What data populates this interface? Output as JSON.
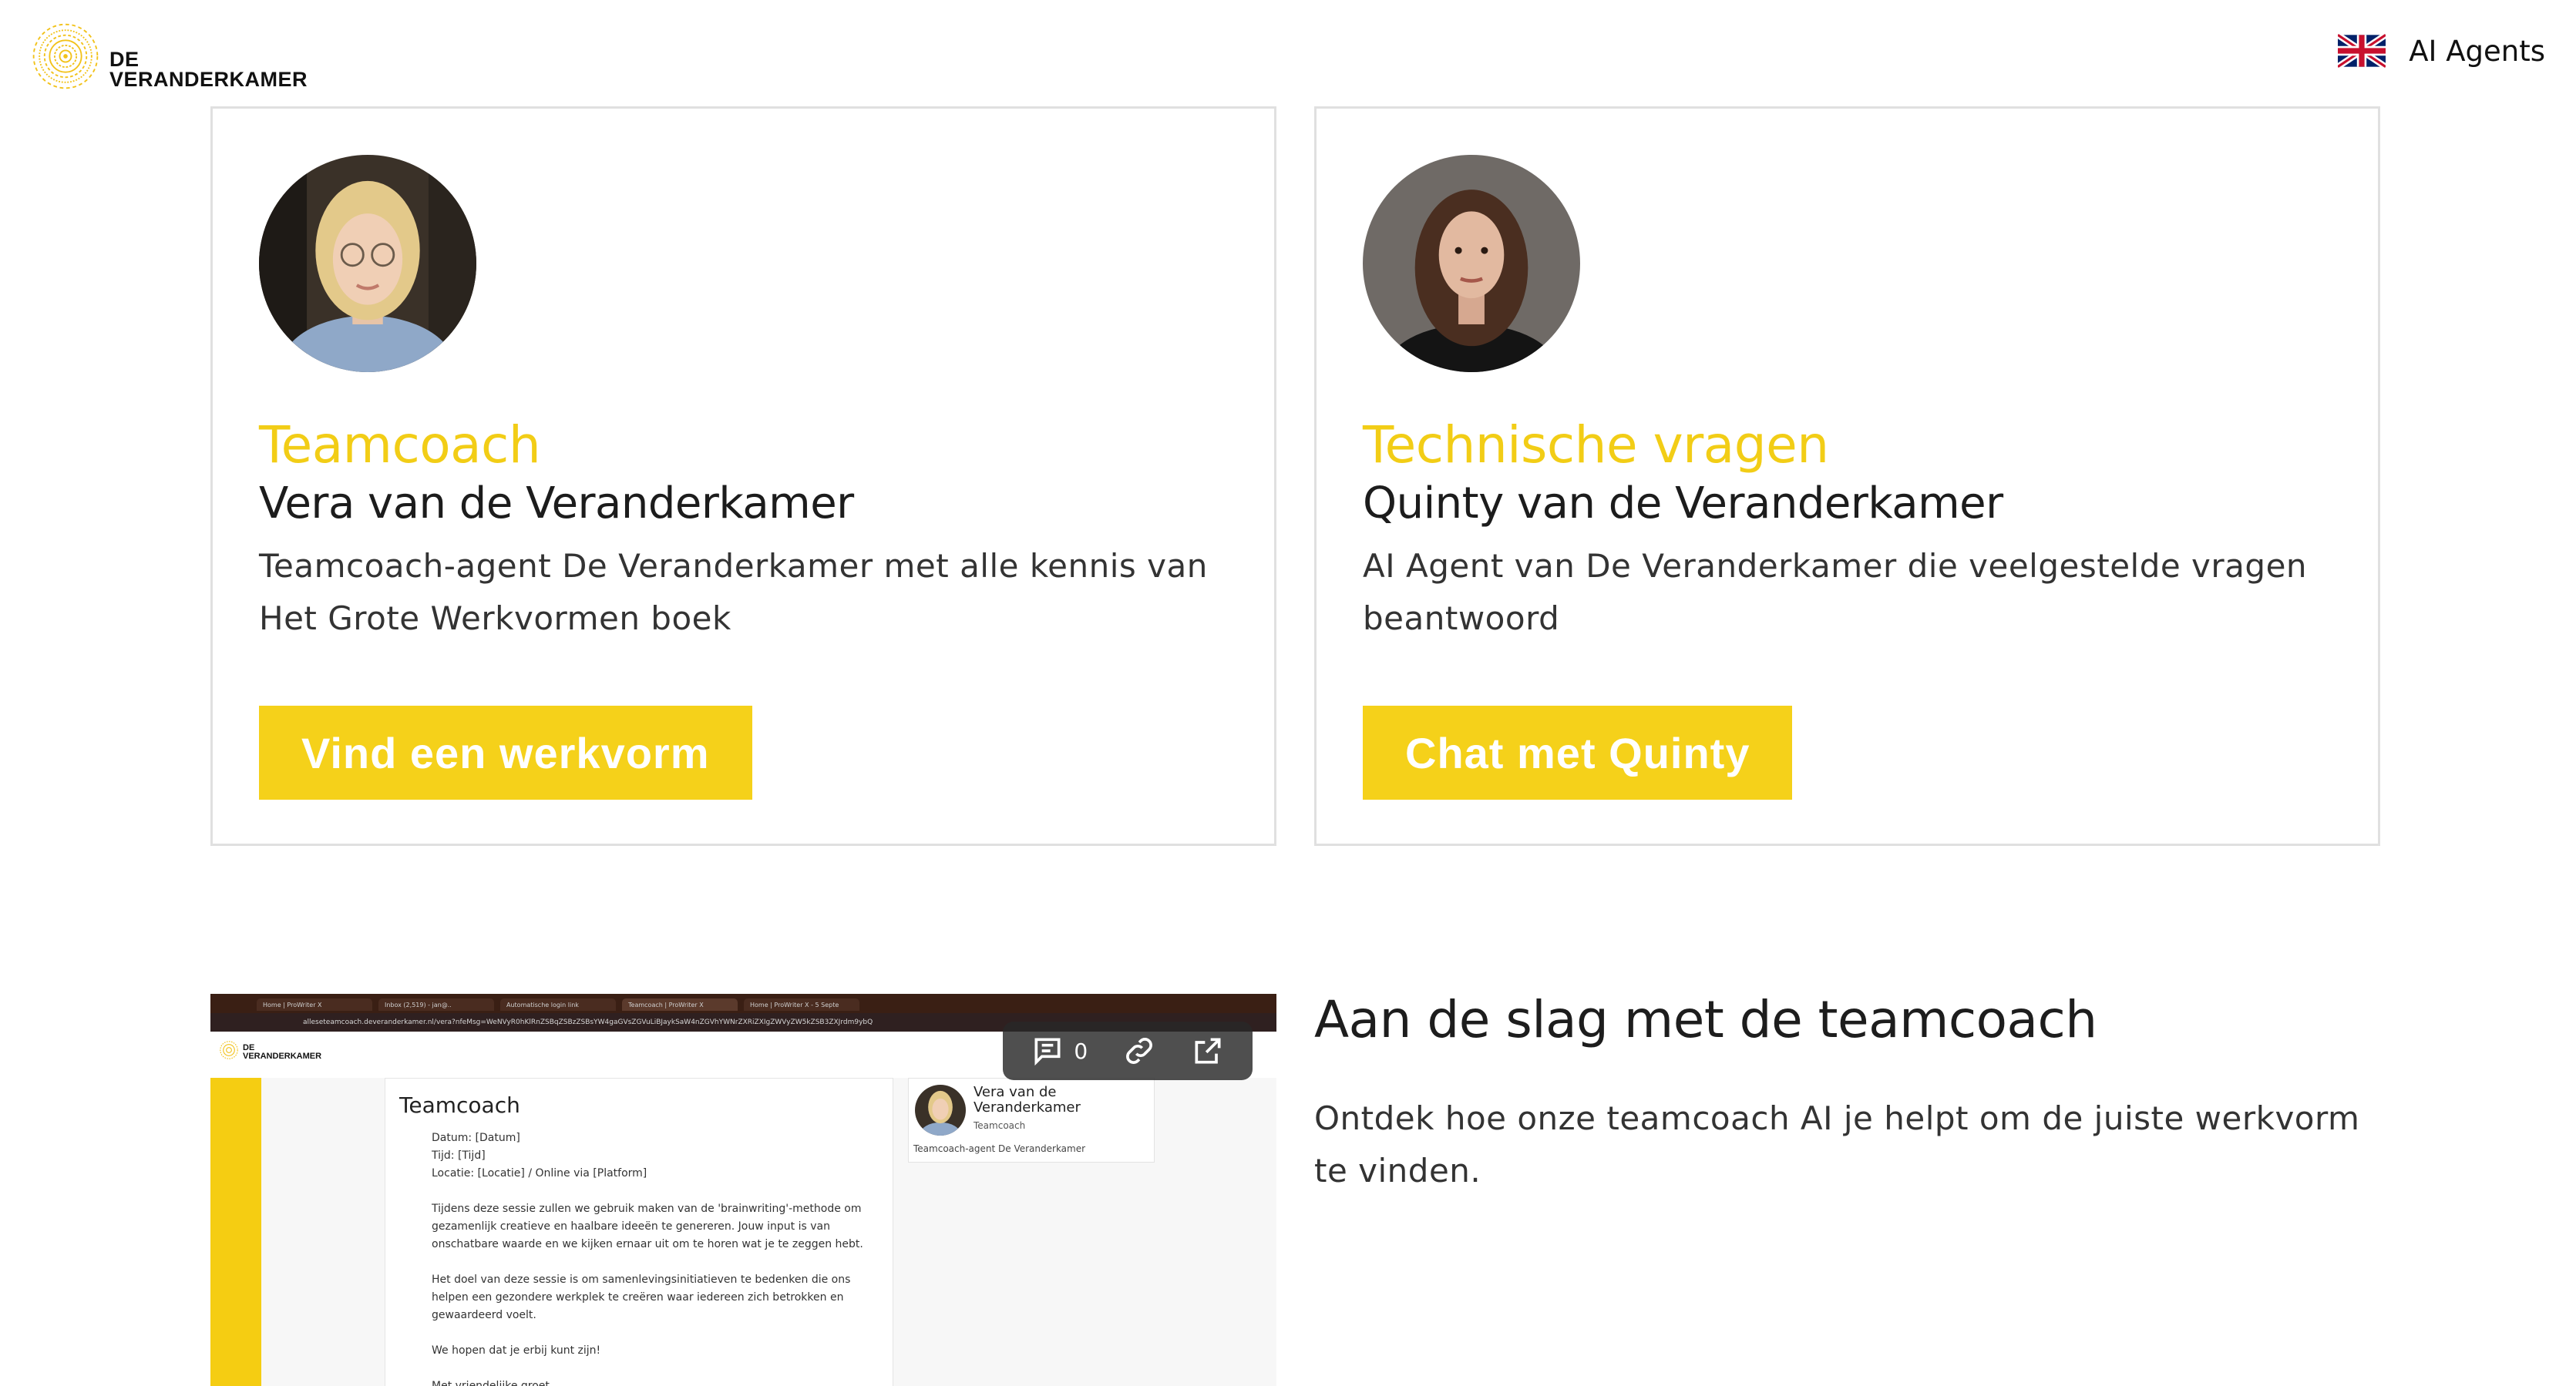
{
  "header": {
    "logo_line1": "DE",
    "logo_line2": "VERANDERKAMER",
    "language_icon": "uk-flag-icon",
    "nav_label": "AI Agents"
  },
  "cards": [
    {
      "role": "Teamcoach",
      "name": "Vera van de Veranderkamer",
      "description": "Teamcoach-agent De Veranderkamer met alle kennis van Het Grote Werkvormen boek",
      "button_label": "Vind een werkvorm"
    },
    {
      "role": "Technische vragen",
      "name": "Quinty van de Veranderkamer",
      "description": "AI Agent van De Veranderkamer die veelgestelde vragen beantwoord",
      "button_label": "Chat met Quinty"
    }
  ],
  "video": {
    "tabs": [
      "Home | ProWriter X",
      "Inbox (2,519) - jan@..",
      "Automatische login link",
      "Teamcoach | ProWriter X",
      "Home | ProWriter X - 5 Septe"
    ],
    "url": "alleseteamcoach.deveranderkamer.nl/vera?nfeMsg=WeNVyR0hKlRnZSBqZSBzZSBsYW4gaGVsZGVuLiBJaykSaW4nZGVhYWNrZXRiZXIgZWVyZW5kZSB3ZXJrdm9ybQ",
    "logo_line1": "DE",
    "logo_line2": "VERANDERKAMER",
    "doc_title": "Teamcoach",
    "doc_body": "Datum: [Datum]\nTijd: [Tijd]\nLocatie: [Locatie] / Online via [Platform]\n\nTijdens deze sessie zullen we gebruik maken van de 'brainwriting'-methode om gezamenlijk creatieve en haalbare ideeën te genereren. Jouw input is van onschatbare waarde en we kijken ernaar uit om te horen wat je te zeggen hebt.\n\nHet doel van deze sessie is om samenlevingsinitiatieven te bedenken die ons helpen een gezondere werkplek te creëren waar iedereen zich betrokken en gewaardeerd voelt.\n\nWe hopen dat je erbij kunt zijn!\n\nMet vriendelijke groet,\n\n[Je Naam]\n[Je Functie]",
    "agent_name": "Vera van de Veranderkamer",
    "agent_role": "Teamcoach",
    "agent_desc": "Teamcoach-agent De Veranderkamer",
    "comment_count": "0",
    "toolbar_icons": [
      "comment-icon",
      "link-icon",
      "open-external-icon"
    ]
  },
  "section": {
    "title": "Aan de slag met de teamcoach",
    "description": "Ontdek hoe onze teamcoach AI je helpt om de juiste werkvorm te vinden."
  },
  "colors": {
    "accent": "#f5d11a",
    "role_text": "#f2cd16",
    "card_border": "#e0e0e0"
  }
}
